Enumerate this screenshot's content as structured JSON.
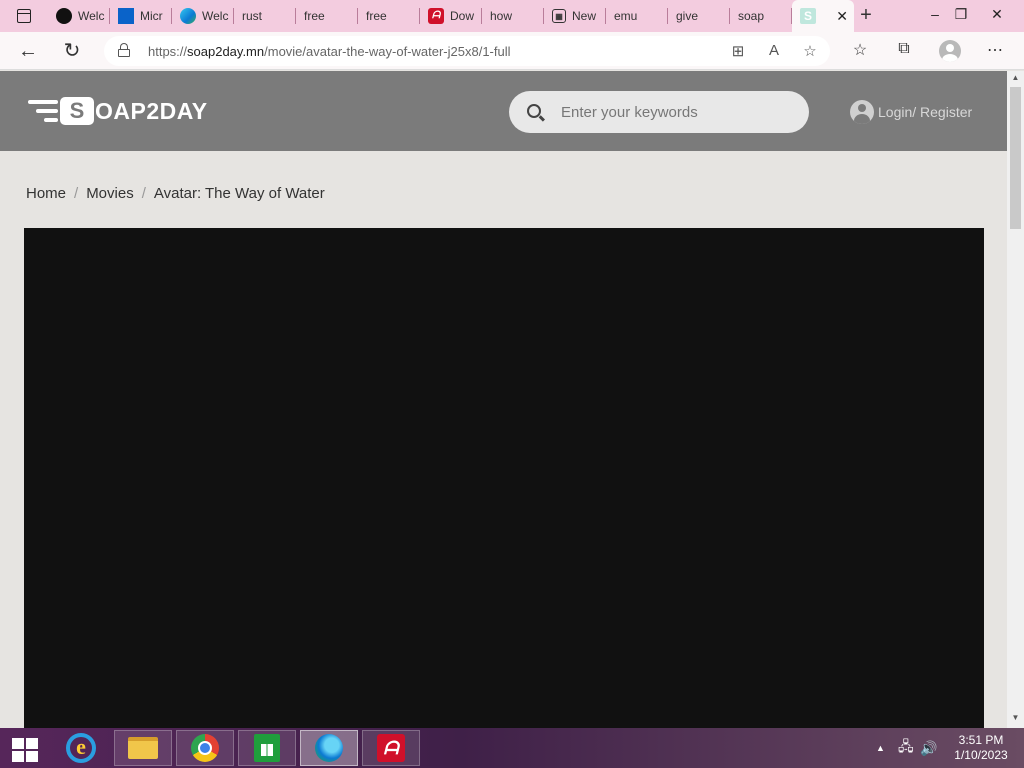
{
  "browser": {
    "tabs": [
      {
        "icon": "edge-dark-icon",
        "title": "Welc"
      },
      {
        "icon": "windows-icon",
        "title": "Micr"
      },
      {
        "icon": "edge-icon",
        "title": "Welc"
      },
      {
        "icon": "search-icon",
        "title": "rust"
      },
      {
        "icon": "search-icon",
        "title": "free"
      },
      {
        "icon": "search-icon",
        "title": "free"
      },
      {
        "icon": "avira-icon",
        "title": "Dow"
      },
      {
        "icon": "search-icon",
        "title": "how"
      },
      {
        "icon": "news-icon",
        "title": "New"
      },
      {
        "icon": "search-icon",
        "title": "emu"
      },
      {
        "icon": "search-icon",
        "title": "give"
      },
      {
        "icon": "search-icon",
        "title": "soap"
      }
    ],
    "active_tab": {
      "icon": "soap2day-icon",
      "favicon_letter": "S",
      "close": "✕"
    },
    "new_tab": "+",
    "window_controls": {
      "minimize": "–",
      "restore": "❐",
      "close": "✕"
    },
    "url_domain": "soap2day.mn",
    "url_scheme": "https://",
    "url_path": "/movie/avatar-the-way-of-water-j25x8/1-full"
  },
  "site": {
    "logo_letter": "S",
    "logo_text": "OAP2DAY",
    "search_placeholder": "Enter your keywords",
    "login_text": "Login/ Register"
  },
  "breadcrumb": {
    "home": "Home",
    "movies": "Movies",
    "current": "Avatar: The Way of Water",
    "separator": "/"
  },
  "player": {
    "background": "#111111"
  },
  "taskbar": {
    "apps": [
      "internet-explorer-icon",
      "file-explorer-icon",
      "chrome-icon",
      "store-icon",
      "edge-icon",
      "avira-icon"
    ],
    "ie_letter": "e",
    "avira_letter": "ᗩ",
    "time": "3:51 PM",
    "date": "1/10/2023"
  },
  "colors": {
    "tab_strip": "#f3ccdf",
    "site_header": "#7b7b7b",
    "page_bg": "#e6e4e1"
  }
}
